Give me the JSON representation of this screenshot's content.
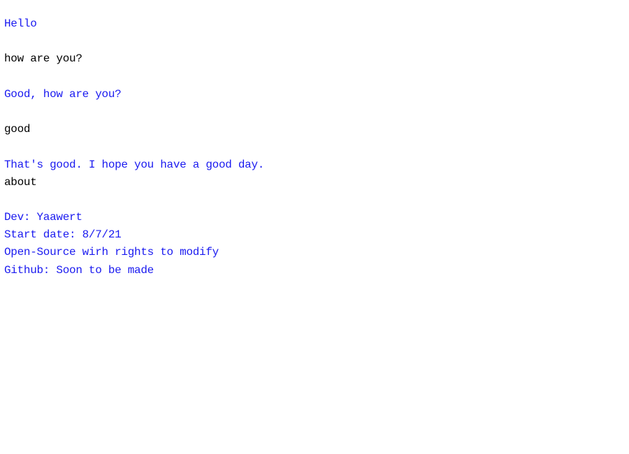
{
  "colors": {
    "background": "#ffffff",
    "bot_text": "#1a1af0",
    "user_text": "#000000"
  },
  "transcript": [
    {
      "role": "bot",
      "text": "Hello"
    },
    {
      "role": "blank",
      "text": ""
    },
    {
      "role": "user",
      "text": "how are you?"
    },
    {
      "role": "blank",
      "text": ""
    },
    {
      "role": "bot",
      "text": "Good, how are you?"
    },
    {
      "role": "blank",
      "text": ""
    },
    {
      "role": "user",
      "text": "good"
    },
    {
      "role": "blank",
      "text": ""
    },
    {
      "role": "bot",
      "text": "That's good. I hope you have a good day."
    },
    {
      "role": "user",
      "text": "about"
    },
    {
      "role": "blank",
      "text": ""
    },
    {
      "role": "bot",
      "text": "Dev: Yaawert"
    },
    {
      "role": "bot",
      "text": "Start date: 8/7/21"
    },
    {
      "role": "bot",
      "text": "Open-Source wirh rights to modify"
    },
    {
      "role": "bot",
      "text": "Github: Soon to be made"
    }
  ]
}
